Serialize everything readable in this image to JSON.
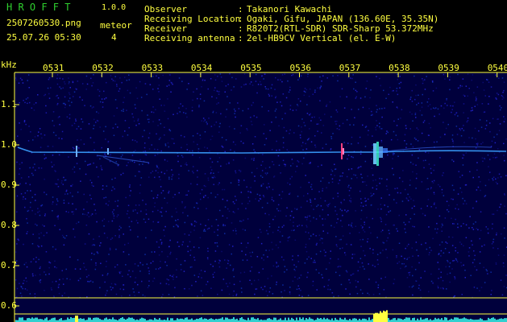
{
  "app": {
    "name": "H R O F F T",
    "version": "1.0.0"
  },
  "file": {
    "name": "2507260530.png",
    "timestamp": "25.07.26 05:30"
  },
  "meteor": {
    "label": "meteor",
    "count": "4"
  },
  "info": [
    {
      "key": "Observer",
      "sep": ":",
      "value": "Takanori Kawachi"
    },
    {
      "key": "Receiving Location",
      "sep": ":",
      "value": "Ogaki, Gifu, JAPAN (136.60E, 35.35N)"
    },
    {
      "key": "Receiver",
      "sep": ":",
      "value": "R820T2(RTL-SDR) SDR-Sharp 53.372MHz"
    },
    {
      "key": "Receiving antenna",
      "sep": ":",
      "value": "2el-HB9CV Vertical (el. E-W)"
    }
  ],
  "axis": {
    "unit": "kHz",
    "time_ticks": [
      "0531",
      "0532",
      "0533",
      "0534",
      "0535",
      "0536",
      "0537",
      "0538",
      "0539",
      "0540"
    ],
    "freq_ticks": [
      "1.1",
      "1.0",
      "0.9",
      "0.8",
      "0.7",
      "0.6"
    ]
  },
  "colors": {
    "background": "#000000",
    "plot_bg": "#00003c",
    "label": "#ffff40",
    "title": "#2fd02f",
    "trace": "#3aa0ff"
  }
}
